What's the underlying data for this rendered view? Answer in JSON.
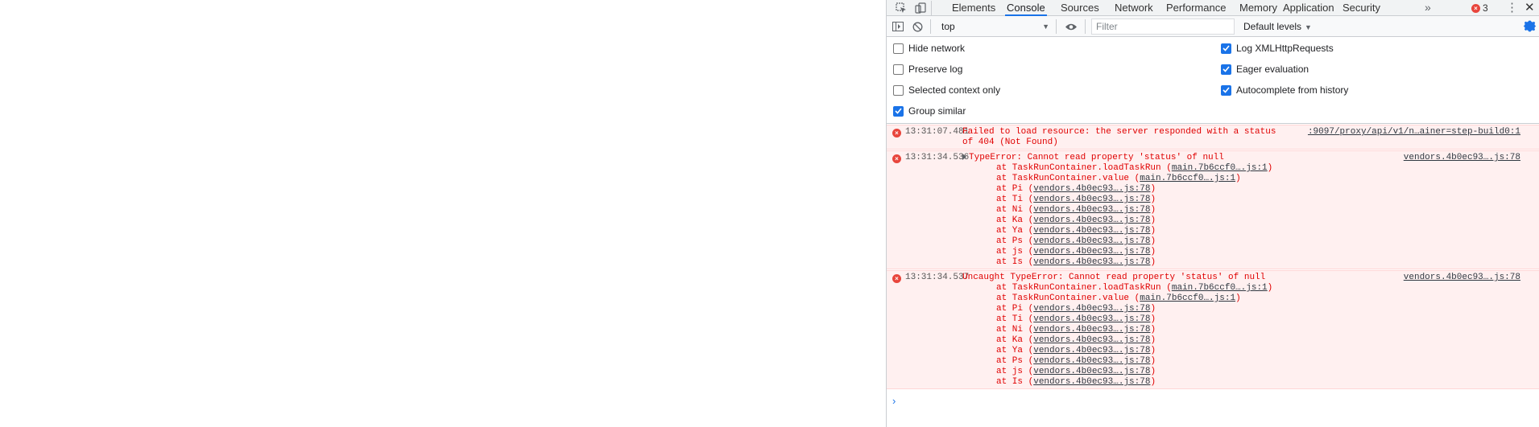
{
  "tabs": [
    "Elements",
    "Console",
    "Sources",
    "Network",
    "Performance",
    "Memory",
    "Application",
    "Security"
  ],
  "active_tab": "Console",
  "more_tabs_glyph": "»",
  "error_count": "3",
  "toolbar": {
    "context": "top",
    "filter_placeholder": "Filter",
    "levels": "Default levels"
  },
  "settings": {
    "left": [
      {
        "label": "Hide network",
        "checked": false
      },
      {
        "label": "Preserve log",
        "checked": false
      },
      {
        "label": "Selected context only",
        "checked": false
      },
      {
        "label": "Group similar",
        "checked": true
      }
    ],
    "right": [
      {
        "label": "Log XMLHttpRequests",
        "checked": true
      },
      {
        "label": "Eager evaluation",
        "checked": true
      },
      {
        "label": "Autocomplete from history",
        "checked": true
      }
    ]
  },
  "messages": [
    {
      "timestamp": "13:31:07.481",
      "text_line1": "Failed to load resource: the server responded with a status",
      "text_line2": "of 404 (Not Found)",
      "source": ":9097/proxy/api/v1/n…ainer=step-build0:1"
    },
    {
      "timestamp": "13:31:34.536",
      "text": "TypeError: Cannot read property 'status' of null",
      "source": "vendors.4b0ec93….js:78",
      "stack": [
        {
          "prefix": "at TaskRunContainer.loadTaskRun (",
          "link": "main.7b6ccf0….js:1",
          "suffix": ")"
        },
        {
          "prefix": "at TaskRunContainer.value (",
          "link": "main.7b6ccf0….js:1",
          "suffix": ")"
        },
        {
          "prefix": "at Pi (",
          "link": "vendors.4b0ec93….js:78",
          "suffix": ")"
        },
        {
          "prefix": "at Ti (",
          "link": "vendors.4b0ec93….js:78",
          "suffix": ")"
        },
        {
          "prefix": "at Ni (",
          "link": "vendors.4b0ec93….js:78",
          "suffix": ")"
        },
        {
          "prefix": "at Ka (",
          "link": "vendors.4b0ec93….js:78",
          "suffix": ")"
        },
        {
          "prefix": "at Ya (",
          "link": "vendors.4b0ec93….js:78",
          "suffix": ")"
        },
        {
          "prefix": "at Ps (",
          "link": "vendors.4b0ec93….js:78",
          "suffix": ")"
        },
        {
          "prefix": "at js (",
          "link": "vendors.4b0ec93….js:78",
          "suffix": ")"
        },
        {
          "prefix": "at Is (",
          "link": "vendors.4b0ec93….js:78",
          "suffix": ")"
        }
      ]
    },
    {
      "timestamp": "13:31:34.537",
      "text": "Uncaught TypeError: Cannot read property 'status' of null",
      "source": "vendors.4b0ec93….js:78",
      "stack": [
        {
          "prefix": "at TaskRunContainer.loadTaskRun (",
          "link": "main.7b6ccf0….js:1",
          "suffix": ")"
        },
        {
          "prefix": "at TaskRunContainer.value (",
          "link": "main.7b6ccf0….js:1",
          "suffix": ")"
        },
        {
          "prefix": "at Pi (",
          "link": "vendors.4b0ec93….js:78",
          "suffix": ")"
        },
        {
          "prefix": "at Ti (",
          "link": "vendors.4b0ec93….js:78",
          "suffix": ")"
        },
        {
          "prefix": "at Ni (",
          "link": "vendors.4b0ec93….js:78",
          "suffix": ")"
        },
        {
          "prefix": "at Ka (",
          "link": "vendors.4b0ec93….js:78",
          "suffix": ")"
        },
        {
          "prefix": "at Ya (",
          "link": "vendors.4b0ec93….js:78",
          "suffix": ")"
        },
        {
          "prefix": "at Ps (",
          "link": "vendors.4b0ec93….js:78",
          "suffix": ")"
        },
        {
          "prefix": "at js (",
          "link": "vendors.4b0ec93….js:78",
          "suffix": ")"
        },
        {
          "prefix": "at Is (",
          "link": "vendors.4b0ec93….js:78",
          "suffix": ")"
        }
      ]
    }
  ],
  "prompt_glyph": "›",
  "colors": {
    "accent": "#1a73e8",
    "error": "#e00000",
    "error_bg": "#fff0f0"
  }
}
